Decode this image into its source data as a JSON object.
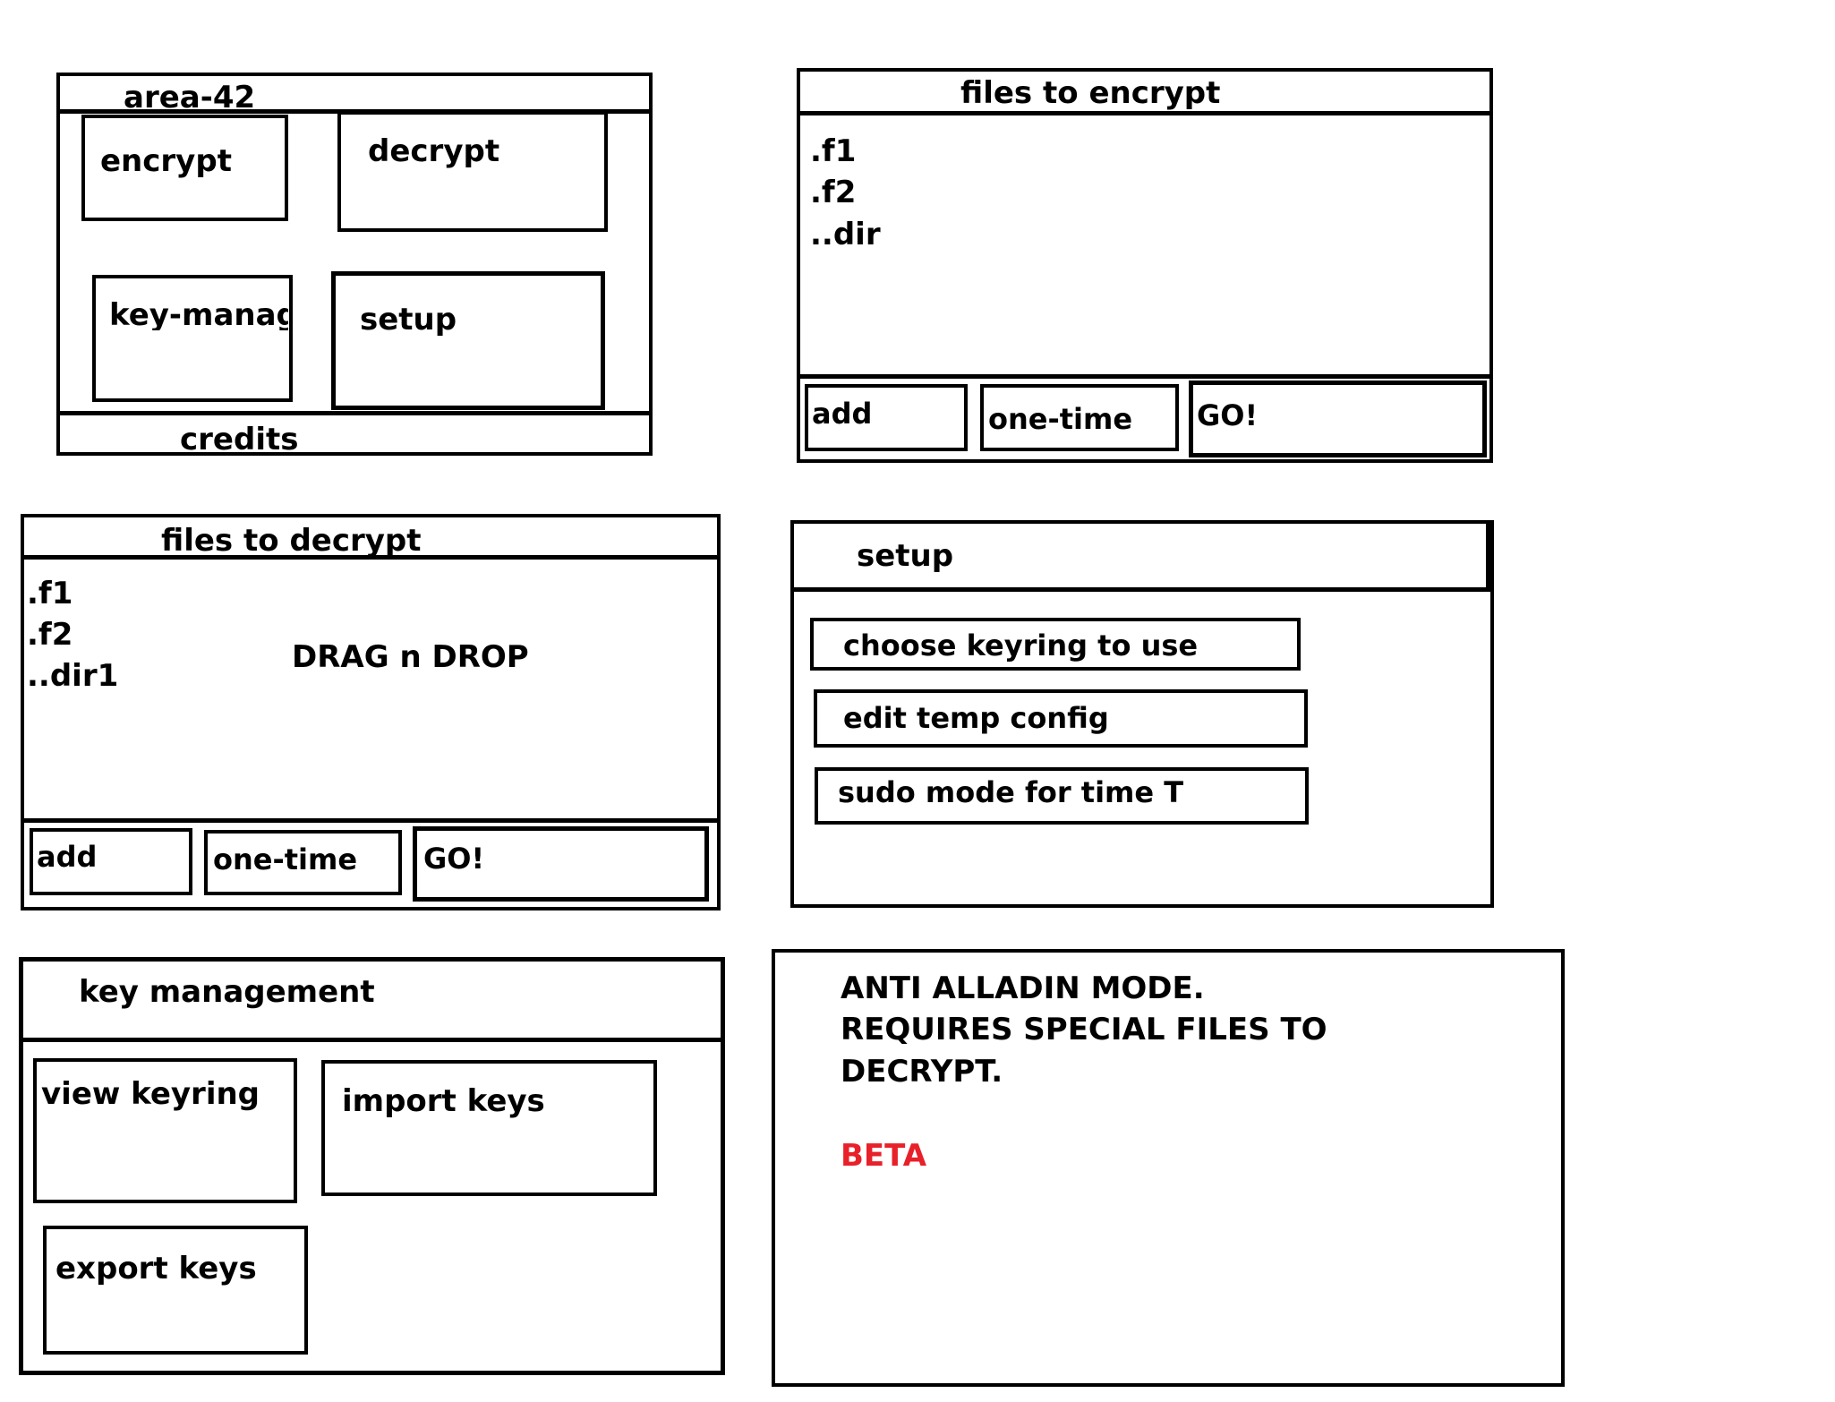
{
  "main_window": {
    "title": "area-42",
    "buttons": {
      "encrypt": "encrypt",
      "decrypt": "decrypt",
      "key_management": "key-manag",
      "setup": "setup"
    },
    "footer": "credits"
  },
  "encrypt_window": {
    "title": "files to encrypt",
    "files": [
      ".f1",
      ".f2",
      "..dir"
    ],
    "buttons": {
      "add": "add",
      "one_time": "one-time",
      "go": "GO!"
    }
  },
  "decrypt_window": {
    "title": "files to decrypt",
    "files": [
      ".f1",
      ".f2",
      "..dir1"
    ],
    "drop_hint": "DRAG n DROP",
    "buttons": {
      "add": "add",
      "one_time": "one-time",
      "go": "GO!"
    }
  },
  "setup_window": {
    "title": "setup",
    "options": [
      "choose keyring to use",
      "edit temp config",
      "sudo mode for time T"
    ]
  },
  "key_management_window": {
    "title": "key management",
    "buttons": {
      "view": "view keyring",
      "import": "import keys",
      "export": "export keys"
    }
  },
  "info_panel": {
    "lines": [
      "ANTI ALLADIN MODE.",
      "REQUIRES SPECIAL FILES TO",
      "DECRYPT."
    ],
    "badge": "BETA",
    "badge_color": "#e8202a"
  }
}
